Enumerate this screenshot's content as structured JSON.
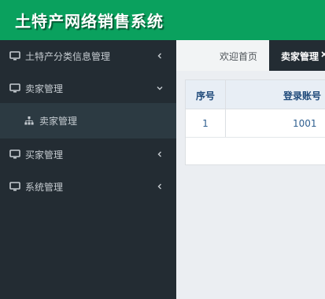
{
  "app": {
    "title": "土特产网络销售系统"
  },
  "sidebar": {
    "items": [
      {
        "label": "土特产分类信息管理",
        "icon": "monitor-icon",
        "arrow": "chevron-left"
      },
      {
        "label": "卖家管理",
        "icon": "monitor-icon",
        "arrow": "chevron-down",
        "expanded": true,
        "children": [
          {
            "label": "卖家管理",
            "icon": "sitemap-icon"
          }
        ]
      },
      {
        "label": "买家管理",
        "icon": "monitor-icon",
        "arrow": "chevron-left"
      },
      {
        "label": "系统管理",
        "icon": "monitor-icon",
        "arrow": "chevron-left"
      }
    ]
  },
  "tabs": [
    {
      "label": "欢迎首页",
      "active": false
    },
    {
      "label": "卖家管理",
      "active": true,
      "close_icon": "close-icon"
    }
  ],
  "table": {
    "columns": [
      "序号",
      "登录账号"
    ],
    "rows": [
      {
        "index": "1",
        "account": "1001"
      }
    ]
  },
  "colors": {
    "header": "#0aa15e",
    "sidebar": "#232c33",
    "submenu": "#2c3a42",
    "active_tab": "#232c33",
    "table_header": "#e8eef5",
    "table_text": "#2f5f90"
  }
}
